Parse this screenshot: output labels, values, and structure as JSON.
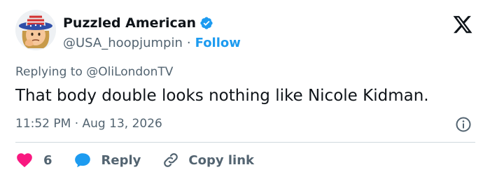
{
  "author": {
    "display_name": "Puzzled American",
    "handle": "@USA_hoopjumpin",
    "separator": "·",
    "follow_label": "Follow",
    "avatar_icon": "uncle-sam-hat-emoji-avatar",
    "verified_icon": "verified-badge-icon"
  },
  "platform": {
    "logo_icon": "x-logo-icon"
  },
  "tweet": {
    "replying_to": "Replying to @OliLondonTV",
    "text": "That body double looks nothing like Nicole Kidman.",
    "timestamp": "11:52 PM · Aug 13, 2026",
    "info_icon": "info-icon"
  },
  "actions": {
    "like_count": "6",
    "reply_label": "Reply",
    "copy_link_label": "Copy link"
  },
  "colors": {
    "accent": "#1d9bf0",
    "like": "#f91880",
    "text_primary": "#0f1419",
    "text_secondary": "#536471",
    "divider": "#cfd9de"
  }
}
